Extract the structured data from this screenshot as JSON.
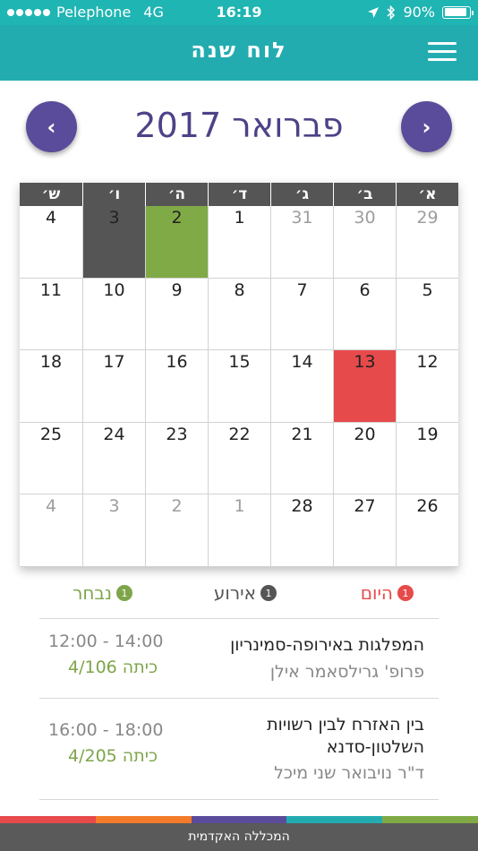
{
  "status_bar": {
    "carrier": "Pelephone",
    "network": "4G",
    "time": "16:19",
    "battery": "90%",
    "battery_level": 0.9
  },
  "header": {
    "title": "לוח שנה",
    "menu_icon": "hamburger-menu-icon"
  },
  "month_nav": {
    "title": "פברואר 2017",
    "prev_label": "‹",
    "next_label": "›"
  },
  "calendar": {
    "weekdays": [
      "א׳",
      "ב׳",
      "ג׳",
      "ד׳",
      "ה׳",
      "ו׳",
      "ש׳"
    ],
    "weeks": [
      [
        {
          "d": "29",
          "s": "other"
        },
        {
          "d": "30",
          "s": "other"
        },
        {
          "d": "31",
          "s": "other"
        },
        {
          "d": "1",
          "s": ""
        },
        {
          "d": "2",
          "s": "selected"
        },
        {
          "d": "3",
          "s": "event"
        },
        {
          "d": "4",
          "s": ""
        }
      ],
      [
        {
          "d": "5",
          "s": ""
        },
        {
          "d": "6",
          "s": ""
        },
        {
          "d": "7",
          "s": ""
        },
        {
          "d": "8",
          "s": ""
        },
        {
          "d": "9",
          "s": ""
        },
        {
          "d": "10",
          "s": ""
        },
        {
          "d": "11",
          "s": ""
        }
      ],
      [
        {
          "d": "12",
          "s": ""
        },
        {
          "d": "13",
          "s": "today"
        },
        {
          "d": "14",
          "s": ""
        },
        {
          "d": "15",
          "s": ""
        },
        {
          "d": "16",
          "s": ""
        },
        {
          "d": "17",
          "s": ""
        },
        {
          "d": "18",
          "s": ""
        }
      ],
      [
        {
          "d": "19",
          "s": ""
        },
        {
          "d": "20",
          "s": ""
        },
        {
          "d": "21",
          "s": ""
        },
        {
          "d": "22",
          "s": ""
        },
        {
          "d": "23",
          "s": ""
        },
        {
          "d": "24",
          "s": ""
        },
        {
          "d": "25",
          "s": ""
        }
      ],
      [
        {
          "d": "26",
          "s": ""
        },
        {
          "d": "27",
          "s": ""
        },
        {
          "d": "28",
          "s": ""
        },
        {
          "d": "1",
          "s": "other"
        },
        {
          "d": "2",
          "s": "other"
        },
        {
          "d": "3",
          "s": "other"
        },
        {
          "d": "4",
          "s": "other"
        }
      ]
    ]
  },
  "legend": {
    "today": {
      "label": "היום",
      "count": "1"
    },
    "event": {
      "label": "אירוע",
      "count": "1"
    },
    "selected": {
      "label": "נבחר",
      "count": "1"
    }
  },
  "events": [
    {
      "title": "המפלגות באירופה-סמינריון",
      "lecturer": "פרופ' גרילסאמר אילן",
      "time": "12:00 - 14:00",
      "room": "כיתה 4/106"
    },
    {
      "title_line1": "בין האזרח לבין רשויות",
      "title_line2": "השלטון-סדנא",
      "lecturer": "ד\"ר נויבואר שני מיכל",
      "time": "16:00 - 18:00",
      "room": "כיתה 4/205"
    }
  ],
  "footer": {
    "text": "המכללה האקדמית",
    "stripe_colors": [
      "#e74a4b",
      "#f47b2a",
      "#5b4b9b",
      "#23acb0",
      "#80aa46"
    ]
  },
  "colors": {
    "header": "#23acb0",
    "accent_purple": "#5b4b9b",
    "today_red": "#e74a4b",
    "event_gray": "#555555",
    "selected_green": "#80aa46"
  }
}
